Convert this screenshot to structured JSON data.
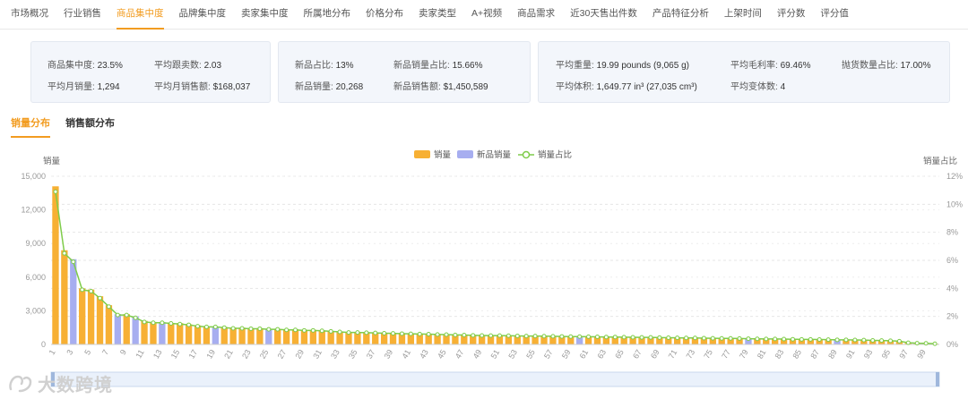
{
  "nav": {
    "tabs": [
      {
        "label": "市场概况",
        "active": false
      },
      {
        "label": "行业销售",
        "active": false
      },
      {
        "label": "商品集中度",
        "active": true
      },
      {
        "label": "品牌集中度",
        "active": false
      },
      {
        "label": "卖家集中度",
        "active": false
      },
      {
        "label": "所属地分布",
        "active": false
      },
      {
        "label": "价格分布",
        "active": false
      },
      {
        "label": "卖家类型",
        "active": false
      },
      {
        "label": "A+视频",
        "active": false
      },
      {
        "label": "商品需求",
        "active": false
      },
      {
        "label": "近30天售出件数",
        "active": false
      },
      {
        "label": "产品特征分析",
        "active": false
      },
      {
        "label": "上架时间",
        "active": false
      },
      {
        "label": "评分数",
        "active": false
      },
      {
        "label": "评分值",
        "active": false
      }
    ]
  },
  "stats": {
    "card1": {
      "concentration_label": "商品集中度:",
      "concentration_value": "23.5%",
      "avg_sellers_label": "平均跟卖数:",
      "avg_sellers_value": "2.03",
      "avg_monthly_sales_label": "平均月销量:",
      "avg_monthly_sales_value": "1,294",
      "avg_monthly_revenue_label": "平均月销售额:",
      "avg_monthly_revenue_value": "$168,037"
    },
    "card2": {
      "new_ratio_label": "新品占比:",
      "new_ratio_value": "13%",
      "new_sales_ratio_label": "新品销量占比:",
      "new_sales_ratio_value": "15.66%",
      "new_sales_label": "新品销量:",
      "new_sales_value": "20,268",
      "new_revenue_label": "新品销售额:",
      "new_revenue_value": "$1,450,589"
    },
    "card3": {
      "avg_weight_label": "平均重量:",
      "avg_weight_value": "19.99 pounds (9,065 g)",
      "avg_margin_label": "平均毛利率:",
      "avg_margin_value": "69.46%",
      "fba_ratio_label": "抛货数量占比:",
      "fba_ratio_value": "17.00%",
      "avg_volume_label": "平均体积:",
      "avg_volume_value": "1,649.77 in³ (27,035 cm³)",
      "avg_variants_label": "平均变体数:",
      "avg_variants_value": "4"
    }
  },
  "subtabs": {
    "sales_dist": "销量分布",
    "revenue_dist": "销售额分布"
  },
  "watermark": {
    "text": "大数跨境"
  },
  "chart_data": {
    "type": "bar",
    "ylabel": "销量",
    "y2label": "销量占比",
    "ylim": [
      0,
      15000
    ],
    "y2lim": [
      0,
      12
    ],
    "yticks": [
      "0",
      "3,000",
      "6,000",
      "9,000",
      "12,000",
      "15,000"
    ],
    "y2ticks": [
      "0%",
      "2%",
      "4%",
      "6%",
      "8%",
      "10%",
      "12%"
    ],
    "legend": [
      {
        "name": "销量",
        "color": "#f7b034"
      },
      {
        "name": "新品销量",
        "color": "#a7aef0"
      },
      {
        "name": "销量占比",
        "color": "#7fcc4a"
      }
    ],
    "colors": {
      "sales": "#f7b034",
      "new": "#a7aef0",
      "line": "#7fcc4a"
    },
    "x": [
      1,
      2,
      3,
      4,
      5,
      6,
      7,
      8,
      9,
      10,
      11,
      12,
      13,
      14,
      15,
      16,
      17,
      18,
      19,
      20,
      21,
      22,
      23,
      24,
      25,
      26,
      27,
      28,
      29,
      30,
      31,
      32,
      33,
      34,
      35,
      36,
      37,
      38,
      39,
      40,
      41,
      42,
      43,
      44,
      45,
      46,
      47,
      48,
      49,
      50,
      51,
      52,
      53,
      54,
      55,
      56,
      57,
      58,
      59,
      60,
      61,
      62,
      63,
      64,
      65,
      66,
      67,
      68,
      69,
      70,
      71,
      72,
      73,
      74,
      75,
      76,
      77,
      78,
      79,
      80,
      81,
      82,
      83,
      84,
      85,
      86,
      87,
      88,
      89,
      90,
      91,
      92,
      93,
      94,
      95,
      96,
      97,
      98,
      99,
      100
    ],
    "xticks": [
      "1",
      "3",
      "5",
      "7",
      "9",
      "11",
      "13",
      "15",
      "17",
      "19",
      "21",
      "23",
      "25",
      "27",
      "29",
      "31",
      "33",
      "35",
      "37",
      "39",
      "41",
      "43",
      "45",
      "47",
      "49",
      "51",
      "53",
      "55",
      "57",
      "59",
      "61",
      "63",
      "65",
      "67",
      "69",
      "71",
      "73",
      "75",
      "77",
      "79",
      "81",
      "83",
      "85",
      "87",
      "89",
      "91",
      "93",
      "95",
      "97",
      "99"
    ],
    "sales": [
      14100,
      8400,
      7600,
      5000,
      4900,
      4300,
      3500,
      2700,
      2700,
      2500,
      2100,
      2000,
      2000,
      1900,
      1900,
      1800,
      1700,
      1600,
      1600,
      1550,
      1500,
      1500,
      1450,
      1450,
      1400,
      1400,
      1350,
      1350,
      1300,
      1300,
      1250,
      1200,
      1150,
      1100,
      1100,
      1080,
      1060,
      1040,
      1020,
      1000,
      980,
      960,
      940,
      920,
      900,
      880,
      860,
      840,
      830,
      820,
      810,
      800,
      790,
      780,
      770,
      760,
      750,
      740,
      730,
      720,
      710,
      700,
      690,
      680,
      670,
      660,
      650,
      640,
      630,
      620,
      610,
      600,
      590,
      580,
      570,
      560,
      550,
      540,
      530,
      520,
      510,
      500,
      490,
      480,
      470,
      460,
      450,
      440,
      430,
      420,
      410,
      400,
      380,
      360,
      340,
      300,
      150,
      120,
      100,
      60
    ],
    "is_new": [
      false,
      false,
      true,
      false,
      false,
      false,
      false,
      true,
      false,
      true,
      false,
      false,
      true,
      false,
      false,
      false,
      false,
      false,
      true,
      false,
      false,
      false,
      false,
      false,
      true,
      false,
      false,
      false,
      false,
      false,
      false,
      false,
      false,
      false,
      false,
      false,
      false,
      false,
      false,
      false,
      false,
      false,
      false,
      false,
      false,
      false,
      false,
      false,
      false,
      false,
      false,
      false,
      false,
      false,
      false,
      false,
      false,
      false,
      false,
      true,
      false,
      false,
      false,
      false,
      false,
      false,
      false,
      false,
      false,
      false,
      false,
      false,
      false,
      false,
      false,
      false,
      false,
      false,
      true,
      false,
      false,
      false,
      false,
      false,
      false,
      false,
      false,
      false,
      true,
      false,
      false,
      false,
      false,
      false,
      false,
      false,
      false,
      false,
      false,
      false
    ],
    "share_pct": [
      10.9,
      6.5,
      5.9,
      3.9,
      3.8,
      3.3,
      2.7,
      2.1,
      2.1,
      1.9,
      1.6,
      1.55,
      1.55,
      1.5,
      1.45,
      1.4,
      1.3,
      1.25,
      1.25,
      1.2,
      1.15,
      1.15,
      1.12,
      1.12,
      1.08,
      1.08,
      1.04,
      1.04,
      1.0,
      1.0,
      0.97,
      0.93,
      0.89,
      0.85,
      0.85,
      0.84,
      0.82,
      0.8,
      0.79,
      0.77,
      0.76,
      0.74,
      0.73,
      0.71,
      0.7,
      0.68,
      0.67,
      0.65,
      0.64,
      0.63,
      0.63,
      0.62,
      0.61,
      0.6,
      0.6,
      0.59,
      0.58,
      0.57,
      0.56,
      0.56,
      0.55,
      0.54,
      0.53,
      0.53,
      0.52,
      0.51,
      0.5,
      0.5,
      0.49,
      0.48,
      0.47,
      0.46,
      0.46,
      0.45,
      0.44,
      0.43,
      0.43,
      0.42,
      0.41,
      0.4,
      0.39,
      0.39,
      0.38,
      0.37,
      0.36,
      0.36,
      0.35,
      0.34,
      0.33,
      0.33,
      0.32,
      0.31,
      0.29,
      0.28,
      0.26,
      0.23,
      0.12,
      0.09,
      0.08,
      0.05
    ]
  }
}
